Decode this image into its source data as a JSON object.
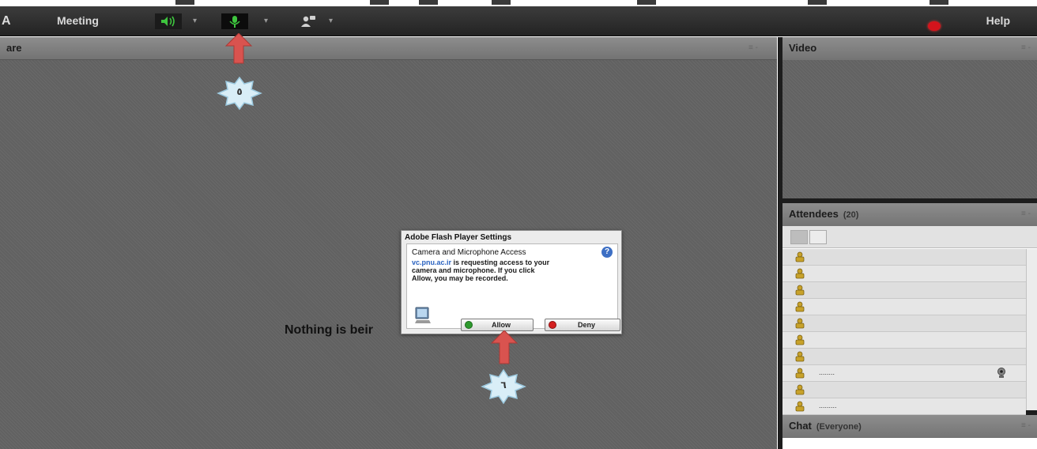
{
  "menubar": {
    "logo_text": "A",
    "meeting_label": "Meeting",
    "help_label": "Help",
    "dropdown_glyph": "▾"
  },
  "share_pod": {
    "title": "are",
    "message": "Nothing is beir"
  },
  "video_pod": {
    "title": "Video"
  },
  "attendees_pod": {
    "title": "Attendees",
    "count": "(20)",
    "rows": [
      {
        "name": ""
      },
      {
        "name": ""
      },
      {
        "name": ""
      },
      {
        "name": ""
      },
      {
        "name": ""
      },
      {
        "name": ""
      },
      {
        "name": ""
      },
      {
        "name": "........",
        "camera": true
      },
      {
        "name": ""
      },
      {
        "name": "........."
      }
    ]
  },
  "chat_pod": {
    "title": "Chat",
    "scope": "(Everyone)"
  },
  "flash_dialog": {
    "title": "Adobe Flash Player Settings",
    "heading": "Camera and Microphone Access",
    "domain": "vc.pnu.ac.ir",
    "body_line1": " is requesting access to your",
    "body_line2": "camera and microphone. If you click",
    "body_line3": "Allow, you may be recorded.",
    "help_glyph": "?",
    "allow_label": "Allow",
    "deny_label": "Deny"
  },
  "annotations": {
    "badge_mic": "٥",
    "badge_allow": "٦"
  },
  "colors": {
    "arrow": "#d9534f",
    "badge": "#d9eef7",
    "speaker_green": "#3ec43e",
    "status_red": "#d4141c"
  }
}
